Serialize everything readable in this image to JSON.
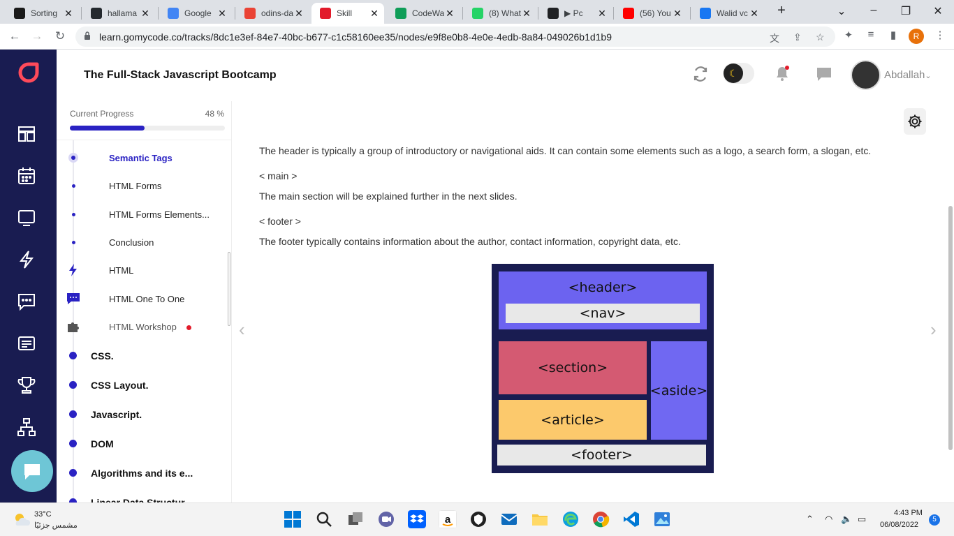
{
  "browser": {
    "tabs": [
      {
        "title": "Sorting",
        "icon": "va-icon",
        "color": "#1a1a1a"
      },
      {
        "title": "hallama",
        "icon": "github-icon",
        "color": "#24292e"
      },
      {
        "title": "Google",
        "icon": "google-translate-icon",
        "color": "#4285f4"
      },
      {
        "title": "odins-da",
        "icon": "chrome-app-icon",
        "color": "#ea4335"
      },
      {
        "title": "Skill",
        "icon": "gomycode-icon",
        "color": "#e21b2b"
      },
      {
        "title": "CodeWa",
        "icon": "sheets-icon",
        "color": "#0f9d58"
      },
      {
        "title": "(8) What",
        "icon": "whatsapp-icon",
        "color": "#25d366"
      },
      {
        "title": "▶ Pc",
        "icon": "media-icon",
        "color": "#202124"
      },
      {
        "title": "(56) You",
        "icon": "youtube-icon",
        "color": "#ff0000"
      },
      {
        "title": "Walid vc",
        "icon": "facebook-icon",
        "color": "#1877f2"
      }
    ],
    "new_tab": "+",
    "url": "learn.gomycode.co/tracks/8dc1e3ef-84e7-40bc-b677-c1c58160ee35/nodes/e9f8e0b8-4e0e-4edb-8a84-049026b1d1b9",
    "profile_initial": "R"
  },
  "app": {
    "course_title": "The Full-Stack Javascript Bootcamp",
    "username": "Abdallah",
    "accent": "#2a22c3",
    "rail_color": "#191c51"
  },
  "sidebar": {
    "progress_label": "Current Progress",
    "progress_value": "48 %",
    "progress_fraction": 0.48,
    "lessons": [
      {
        "label": "Semantic Tags",
        "state": "active"
      },
      {
        "label": "HTML Forms",
        "state": "normal"
      },
      {
        "label": "HTML Forms Elements...",
        "state": "normal"
      },
      {
        "label": "Conclusion",
        "state": "normal"
      },
      {
        "label": "HTML",
        "state": "normal"
      },
      {
        "label": "HTML One To One",
        "state": "normal"
      },
      {
        "label": "HTML Workshop",
        "state": "muted"
      }
    ],
    "sections": [
      "CSS.",
      "CSS Layout.",
      "Javascript.",
      "DOM",
      "Algorithms and its e...",
      "Linear Data Structur..."
    ]
  },
  "content": {
    "p1": "The header is typically a group of introductory or navigational aids. It can contain some elements such as a logo, a search form, a slogan, etc.",
    "h_main": "< main >",
    "p2": "The main section will be explained further in the next slides.",
    "h_footer": "< footer >",
    "p3": "The footer typically contains information about the author, contact information, copyright data, etc.",
    "diagram": {
      "header": "<header>",
      "nav": "<nav>",
      "section": "<section>",
      "article": "<article>",
      "aside": "<aside>",
      "footer": "<footer>",
      "colors": {
        "bg": "#191c51",
        "header": "#6c63f0",
        "nav": "#e8e8e8",
        "section": "#d45a72",
        "article": "#fcc96c",
        "aside": "#7068f2",
        "footer": "#e8e8e8"
      }
    }
  },
  "taskbar": {
    "temperature": "33°C",
    "weather": "مشمس جزئيًا",
    "time": "4:43 PM",
    "date": "06/08/2022",
    "notifications": "5"
  }
}
